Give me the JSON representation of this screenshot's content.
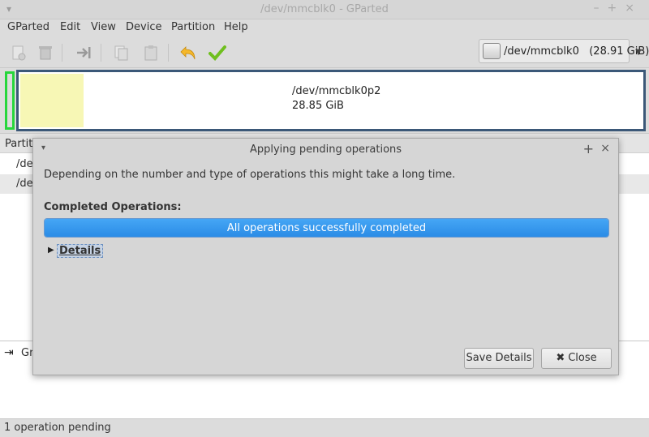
{
  "window": {
    "title": "/dev/mmcblk0 - GParted",
    "menu_glyph": "▾",
    "controls": "–+×"
  },
  "menu": [
    "GParted",
    "Edit",
    "View",
    "Device",
    "Partition",
    "Help"
  ],
  "toolbar": {
    "icons": [
      "new-partition-icon",
      "delete-icon",
      "resize-move-icon",
      "copy-icon",
      "paste-icon",
      "undo-icon",
      "apply-icon"
    ]
  },
  "device_selector": {
    "value": "/dev/mmcblk0   (28.91 GiB)",
    "arrow": "▼"
  },
  "partition_graph": {
    "name": "/dev/mmcblk0p2",
    "size": "28.85 GiB",
    "colors": {
      "selected_border": "#27d63c",
      "partition_border": "#3b5878",
      "used": "#f7f7b5"
    }
  },
  "partition_list": {
    "header_first": "Partiti",
    "rows": [
      "/de",
      "/de"
    ]
  },
  "operations": {
    "first_item": "Gr"
  },
  "status": "1 operation pending",
  "dialog": {
    "title": "Applying pending operations",
    "menu_glyph": "▾",
    "maximize": "+",
    "close_glyph": "×",
    "description": "Depending on the number and type of operations this might take a long time.",
    "completed_label": "Completed Operations:",
    "progress_text": "All operations successfully completed",
    "progress_fraction": 1.0,
    "details_label": "Details",
    "details_arrow": "▶",
    "buttons": {
      "save": "Save Details",
      "close": "Close",
      "close_icon": "✖"
    }
  },
  "colors": {
    "accent": "#2b8ce6",
    "window_bg": "#dcdcdc"
  }
}
